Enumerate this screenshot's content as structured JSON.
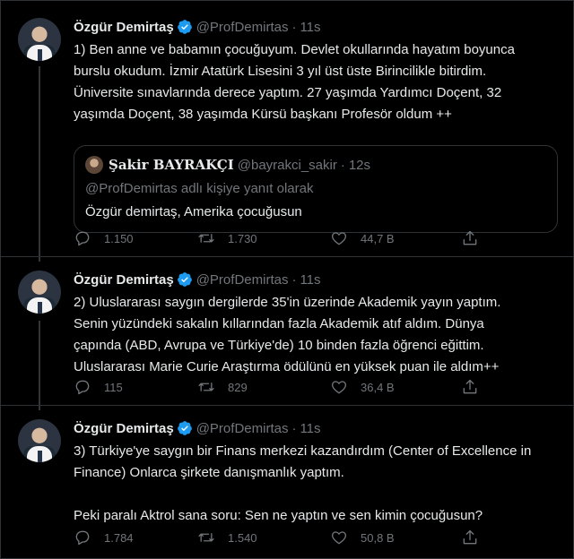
{
  "colors": {
    "background": "#000000",
    "text": "#e7e9ea",
    "muted": "#71767b",
    "verified": "#1d9bf0",
    "border": "#2f3336"
  },
  "icons": {
    "verified": "verified-badge-icon",
    "reply": "reply-icon",
    "retweet": "retweet-icon",
    "like": "heart-icon",
    "share": "share-icon"
  },
  "tweets": [
    {
      "author_name": "Özgür Demirtaş",
      "handle": "@ProfDemirtas",
      "separator": "·",
      "time": "11s",
      "text": "1) Ben anne ve babamın çocuğuyum. Devlet okullarında hayatım boyunca\nburslu okudum. İzmir Atatürk Lisesini 3 yıl üst üste Birincilikle bitirdim.\nÜniversite sınavlarında derece yaptım. 27 yaşımda Yardımcı Doçent, 32\nyaşımda Doçent, 38 yaşımda Kürsü başkanı Profesör oldum ++",
      "quote": {
        "author_name": "Şakir BAYRAKÇI",
        "handle": "@bayrakci_sakir",
        "separator": "·",
        "time": "12s",
        "reply_context": "@ProfDemirtas adlı kişiye yanıt olarak",
        "text": "Özgür demirtaş, Amerika çocuğusun"
      },
      "replies": "1.150",
      "retweets": "1.730",
      "likes": "44,7 B"
    },
    {
      "author_name": "Özgür Demirtaş",
      "handle": "@ProfDemirtas",
      "separator": "·",
      "time": "11s",
      "text": "2) Uluslararası saygın dergilerde 35'in üzerinde Akademik yayın yaptım.\nSenin yüzündeki sakalın kıllarından fazla Akademik atıf aldım. Dünya\nçapında (ABD, Avrupa ve Türkiye'de) 10 binden fazla öğrenci eğittim.\nUluslararası Marie Curie Araştırma ödülünü en yüksek puan ile aldım++",
      "replies": "115",
      "retweets": "829",
      "likes": "36,4 B"
    },
    {
      "author_name": "Özgür Demirtaş",
      "handle": "@ProfDemirtas",
      "separator": "·",
      "time": "11s",
      "text": "3) Türkiye'ye saygın bir Finans merkezi kazandırdım (Center of Excellence in\nFinance) Onlarca şirkete danışmanlık yaptım.\n\nPeki paralı Aktrol sana soru: Sen ne yaptın ve sen kimin çocuğusun?",
      "replies": "1.784",
      "retweets": "1.540",
      "likes": "50,8 B"
    }
  ]
}
